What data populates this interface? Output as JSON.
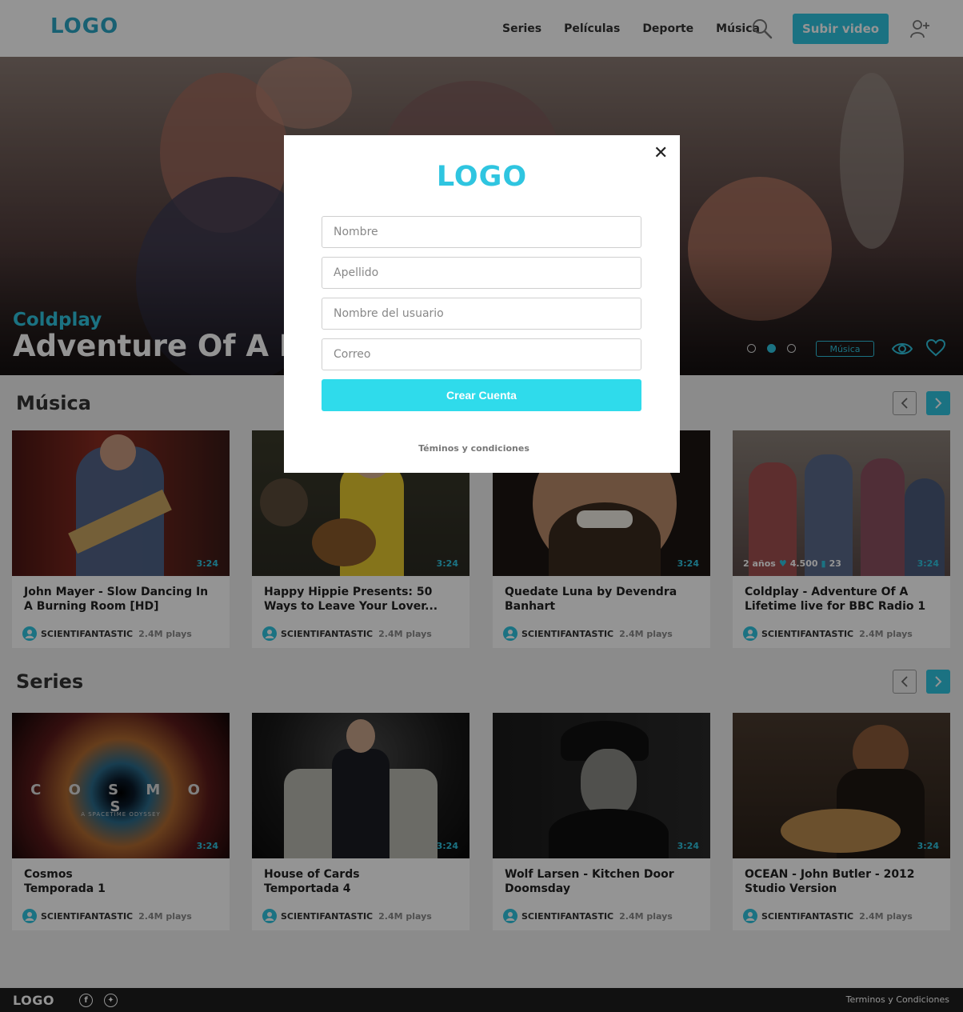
{
  "header": {
    "logo": "LOGO",
    "nav": [
      "Series",
      "Películas",
      "Deporte",
      "Música"
    ],
    "upload_label": "Subir video",
    "icons": [
      "search-icon",
      "add-user-icon"
    ]
  },
  "hero": {
    "artist": "Coldplay",
    "title": "Adventure Of A Lifetime",
    "tag": "Música",
    "active_slide": 2,
    "slide_count": 3
  },
  "sections": [
    {
      "title": "Música",
      "cards": [
        {
          "title": "John Mayer - Slow Dancing In A Burning Room [HD]",
          "duration": "3:24",
          "user": "SCIENTIFANTASTIC",
          "plays": "2.4M plays"
        },
        {
          "title": "Happy Hippie Presents: 50 Ways to Leave Your Lover...",
          "duration": "3:24",
          "user": "SCIENTIFANTASTIC",
          "plays": "2.4M plays"
        },
        {
          "title": "Quedate Luna by Devendra Banhart",
          "duration": "3:24",
          "user": "SCIENTIFANTASTIC",
          "plays": "2.4M plays"
        },
        {
          "title": "Coldplay - Adventure Of A Lifetime live for BBC Radio 1",
          "duration": "3:24",
          "user": "SCIENTIFANTASTIC",
          "plays": "2.4M plays",
          "age": "2 años",
          "likes": "4.500",
          "comments": "23"
        }
      ]
    },
    {
      "title": "Series",
      "cards": [
        {
          "title": "Cosmos\nTemporada 1",
          "duration": "3:24",
          "user": "SCIENTIFANTASTIC",
          "plays": "2.4M plays",
          "thumb_text": "C O S M O S",
          "thumb_sub": "A SPACETIME ODYSSEY"
        },
        {
          "title": "House of Cards\nTemportada 4",
          "duration": "3:24",
          "user": "SCIENTIFANTASTIC",
          "plays": "2.4M plays"
        },
        {
          "title": "Wolf Larsen - Kitchen Door Doomsday",
          "duration": "3:24",
          "user": "SCIENTIFANTASTIC",
          "plays": "2.4M plays"
        },
        {
          "title": "OCEAN - John Butler - 2012 Studio Version",
          "duration": "3:24",
          "user": "SCIENTIFANTASTIC",
          "plays": "2.4M plays"
        }
      ]
    }
  ],
  "modal": {
    "logo": "LOGO",
    "close": "✕",
    "fields": {
      "nombre": "Nombre",
      "apellido": "Apellido",
      "usuario": "Nombre del usuario",
      "correo": "Correo"
    },
    "submit_label": "Crear Cuenta",
    "terms": "Téminos y condiciones"
  },
  "footer": {
    "logo": "LOGO",
    "social": [
      "facebook-icon",
      "twitter-icon"
    ],
    "terms": "Terminos y Condiciones"
  },
  "colors": {
    "accent": "#2fc5e0",
    "logo": "#2aa6c4",
    "button": "#2fdbeb",
    "footer": "#1e1e1e"
  }
}
